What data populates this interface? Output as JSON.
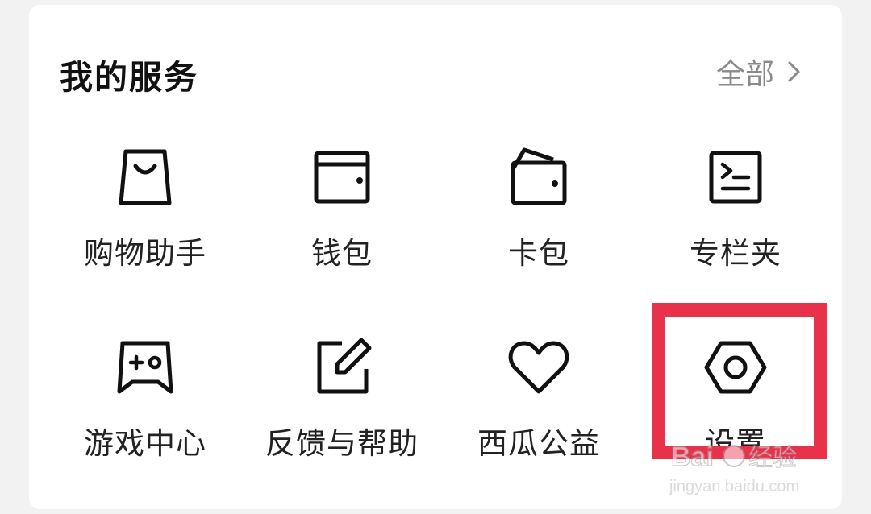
{
  "services": {
    "title": "我的服务",
    "all_label": "全部",
    "items": [
      {
        "label": "购物助手",
        "icon": "shopping-bag-icon"
      },
      {
        "label": "钱包",
        "icon": "wallet-icon"
      },
      {
        "label": "卡包",
        "icon": "card-holder-icon"
      },
      {
        "label": "专栏夹",
        "icon": "column-folder-icon"
      },
      {
        "label": "游戏中心",
        "icon": "gamepad-icon"
      },
      {
        "label": "反馈与帮助",
        "icon": "edit-feedback-icon"
      },
      {
        "label": "西瓜公益",
        "icon": "heart-icon"
      },
      {
        "label": "设置",
        "icon": "settings-hex-icon"
      }
    ]
  },
  "watermark": {
    "brand": "Bai",
    "brand_suffix": "经验",
    "url": "jingyan.baidu.com"
  },
  "colors": {
    "highlight": "#e8314a",
    "text_primary": "#111111",
    "text_secondary": "#8a8a8a",
    "card_bg": "#ffffff",
    "page_bg": "#f2f2f2"
  }
}
